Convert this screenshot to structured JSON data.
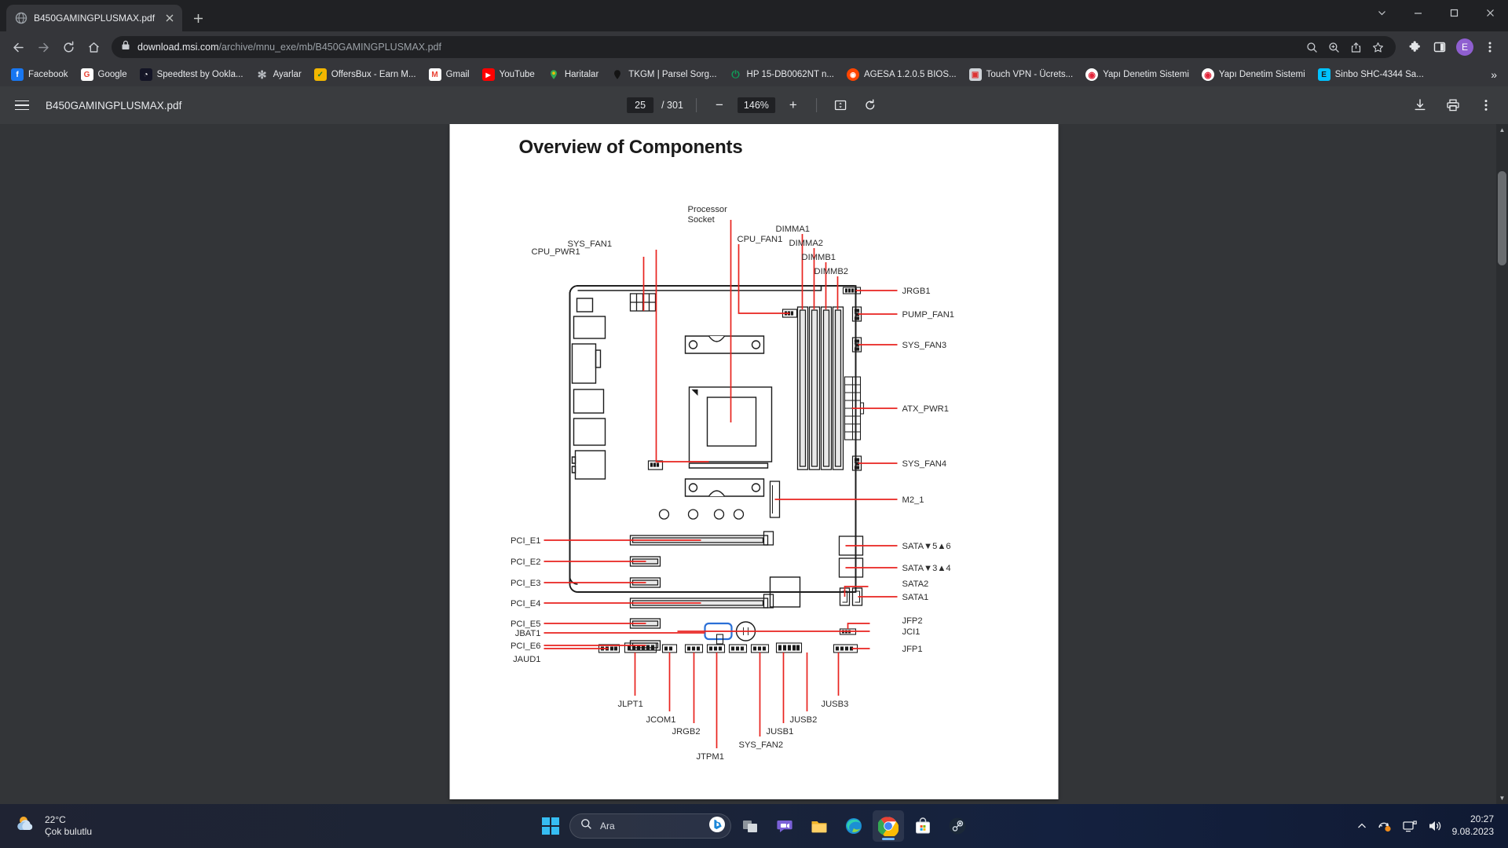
{
  "window": {
    "controls": [
      "minimize-window",
      "maximize-window",
      "close-window"
    ],
    "dropdown_icon": "chevron-down-icon"
  },
  "tabs": [
    {
      "title": "B450GAMINGPLUSMAX.pdf",
      "favicon": "globe-icon",
      "active": true
    }
  ],
  "newtab_label": "+",
  "omnibox": {
    "host": "download.msi.com",
    "path": "/archive/mnu_exe/mb/B450GAMINGPLUSMAX.pdf",
    "lock_icon": "lock-icon",
    "actions": [
      "search-icon",
      "zoom-icon",
      "share-icon",
      "bookmark-star-icon"
    ]
  },
  "toolbar": {
    "back": "back-arrow-icon",
    "forward": "forward-arrow-icon",
    "reload": "reload-icon",
    "home": "home-icon",
    "extensions": "puzzle-piece-icon",
    "sidepanel": "side-panel-icon",
    "avatar_letter": "E",
    "menu": "three-dot-menu-icon"
  },
  "bookmarks": [
    {
      "label": "Facebook",
      "icon": "facebook-icon",
      "color": "#1877f2",
      "glyph": "f"
    },
    {
      "label": "Google",
      "icon": "google-icon",
      "color": "#ffffff",
      "glyph": "G"
    },
    {
      "label": "Speedtest by Ookla...",
      "icon": "speedtest-icon",
      "color": "#141526",
      "glyph": "◔"
    },
    {
      "label": "Ayarlar",
      "icon": "gear-icon",
      "color": "#9aa0a6",
      "glyph": "✿"
    },
    {
      "label": "OffersBux - Earn M...",
      "icon": "offersbux-icon",
      "color": "#f2b600",
      "glyph": "✓"
    },
    {
      "label": "Gmail",
      "icon": "gmail-icon",
      "color": "#ffffff",
      "glyph": "M"
    },
    {
      "label": "YouTube",
      "icon": "youtube-icon",
      "color": "#ff0000",
      "glyph": "▶"
    },
    {
      "label": "Haritalar",
      "icon": "google-maps-pin-icon",
      "color": "#ffffff",
      "glyph": "📍"
    },
    {
      "label": "TKGM | Parsel Sorg...",
      "icon": "map-pin-icon",
      "color": "#1b1b1b",
      "glyph": "📍"
    },
    {
      "label": "HP 15-DB0062NT n...",
      "icon": "power-icon",
      "color": "#0f9d58",
      "glyph": "⏻"
    },
    {
      "label": "AGESA 1.2.0.5 BIOS...",
      "icon": "reddit-icon",
      "color": "#ff4500",
      "glyph": "◉"
    },
    {
      "label": "Touch VPN - Ücrets...",
      "icon": "touchvpn-icon",
      "color": "#cfd3d8",
      "glyph": "▣"
    },
    {
      "label": "Yapı Denetim Sistemi",
      "icon": "circle-target-icon",
      "color": "#ffffff",
      "glyph": "◉"
    },
    {
      "label": "Yapı Denetim Sistemi",
      "icon": "circle-target-icon",
      "color": "#ffffff",
      "glyph": "◉"
    },
    {
      "label": "Sinbo SHC-4344 Sa...",
      "icon": "epey-icon",
      "color": "#00c2ff",
      "glyph": "E"
    }
  ],
  "bookmarks_overflow": "»",
  "pdf": {
    "menu_icon": "hamburger-menu-icon",
    "filename": "B450GAMINGPLUSMAX.pdf",
    "current_page": "25",
    "page_total": "/ 301",
    "zoom_out": "−",
    "zoom_level": "146%",
    "zoom_in": "+",
    "fit_icon": "fit-to-page-icon",
    "rotate_icon": "rotate-icon",
    "download_icon": "download-icon",
    "print_icon": "print-icon",
    "more_icon": "three-dot-menu-icon"
  },
  "document": {
    "heading": "Overview of Components",
    "diagram_name": "msi-b450-gaming-plus-max-motherboard-layout",
    "labels_top": [
      "CPU_PWR1",
      "SYS_FAN1",
      "Processor Socket",
      "CPU_FAN1",
      "DIMMA1",
      "DIMMA2",
      "DIMMB1",
      "DIMMB2"
    ],
    "labels_right": [
      "JRGB1",
      "PUMP_FAN1",
      "SYS_FAN3",
      "ATX_PWR1",
      "SYS_FAN4",
      "M2_1",
      "SATA▼5▲6",
      "SATA▼3▲4",
      "SATA2",
      "SATA1",
      "JCI1",
      "JFP2",
      "JFP1"
    ],
    "labels_left": [
      "PCI_E1",
      "PCI_E2",
      "PCI_E3",
      "PCI_E4",
      "PCI_E5",
      "JBAT1",
      "PCI_E6",
      "JAUD1"
    ],
    "labels_bottom": [
      "JLPT1",
      "JCOM1",
      "JRGB2",
      "JTPM1",
      "SYS_FAN2",
      "JUSB1",
      "JUSB2",
      "JUSB3"
    ]
  },
  "taskbar": {
    "weather": {
      "temp": "22°C",
      "condition": "Çok bulutlu",
      "icon": "partly-cloudy-icon"
    },
    "start_icon": "windows-start-icon",
    "search_placeholder": "Ara",
    "search_icon": "search-icon",
    "copilot_icon": "bing-copilot-icon",
    "apps": [
      {
        "name": "task-view",
        "icon": "task-view-icon"
      },
      {
        "name": "chat",
        "icon": "chat-teams-icon"
      },
      {
        "name": "file-explorer",
        "icon": "folder-icon"
      },
      {
        "name": "microsoft-edge",
        "icon": "edge-icon"
      },
      {
        "name": "google-chrome",
        "icon": "chrome-icon",
        "active": true
      },
      {
        "name": "microsoft-store",
        "icon": "store-icon"
      },
      {
        "name": "steam",
        "icon": "steam-icon"
      }
    ],
    "tray": {
      "show_hidden": "chevron-up-icon",
      "onedrive": "onedrive-sync-icon",
      "network": "network-icon",
      "volume": "volume-icon"
    },
    "clock": {
      "time": "20:27",
      "date": "9.08.2023"
    }
  }
}
